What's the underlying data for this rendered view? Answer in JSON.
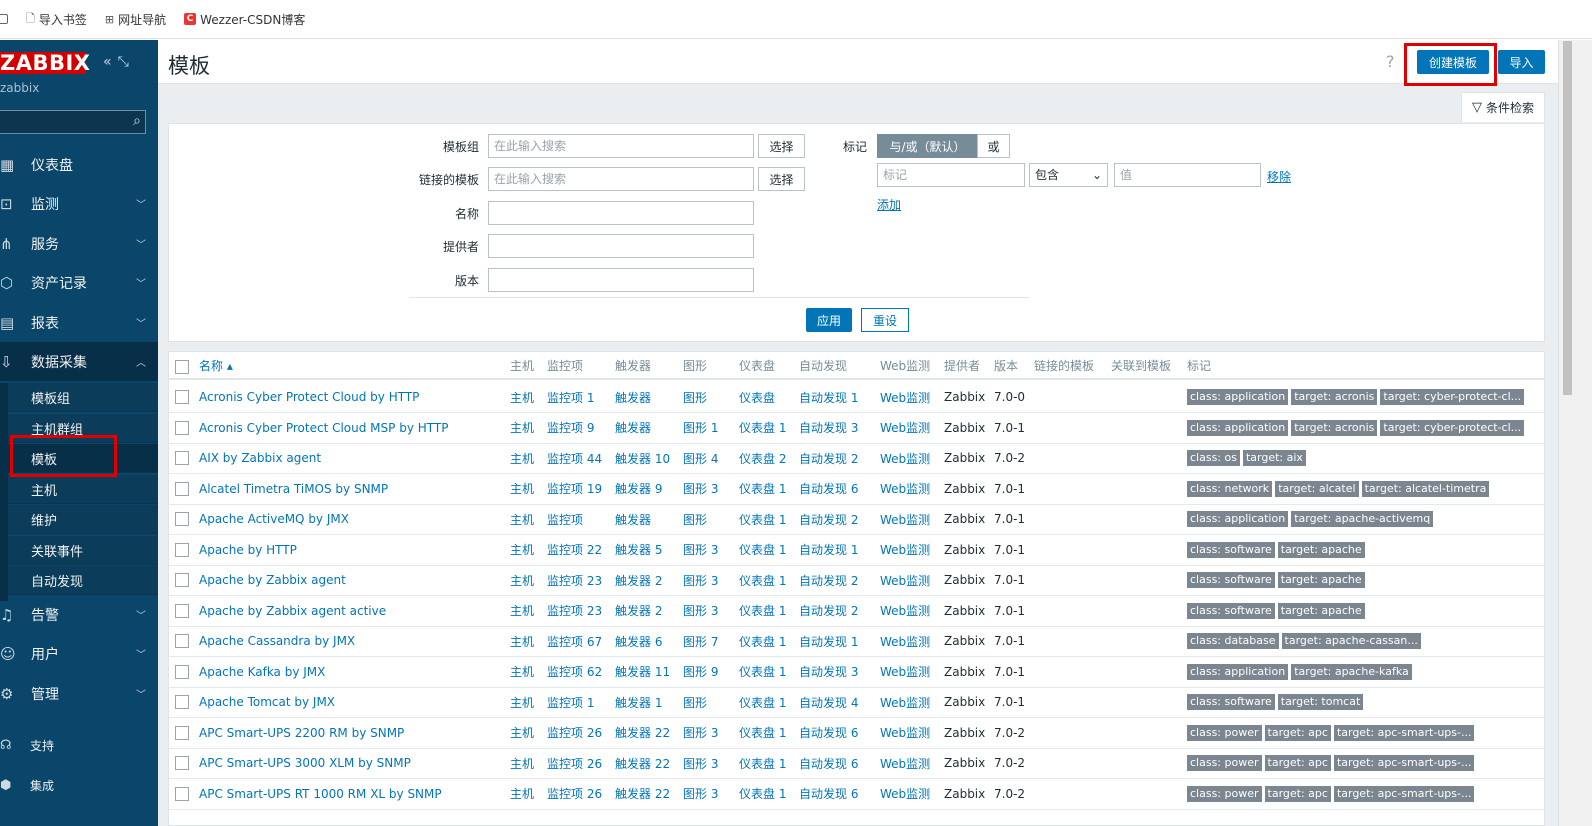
{
  "bookmarks": [
    {
      "label": "导入书签"
    },
    {
      "label": "网址导航"
    },
    {
      "label": "Wezzer-CSDN博客"
    }
  ],
  "sidebar": {
    "logo": "ZABBIX",
    "user": "zabbix",
    "nav": [
      {
        "label": "仪表盘",
        "icon": "grid-icon"
      },
      {
        "label": "监测",
        "icon": "monitor-icon"
      },
      {
        "label": "服务",
        "icon": "tree-icon"
      },
      {
        "label": "资产记录",
        "icon": "cube-icon"
      },
      {
        "label": "报表",
        "icon": "report-icon"
      },
      {
        "label": "数据采集",
        "icon": "download-icon"
      }
    ],
    "sub": [
      "模板组",
      "主机群组",
      "模板",
      "主机",
      "维护",
      "关联事件",
      "自动发现"
    ],
    "nav2": [
      {
        "label": "告警",
        "icon": "bell-icon"
      },
      {
        "label": "用户",
        "icon": "user-icon"
      },
      {
        "label": "管理",
        "icon": "gear-icon"
      }
    ],
    "small": [
      {
        "label": "支持",
        "icon": "headset-icon"
      },
      {
        "label": "集成",
        "icon": "box-icon"
      }
    ]
  },
  "header": {
    "title": "模板",
    "help": "?",
    "create": "创建模板",
    "import": "导入"
  },
  "filter": {
    "tab": "条件检索",
    "labels": {
      "group": "模板组",
      "linked": "链接的模板",
      "name": "名称",
      "vendor": "提供者",
      "version": "版本",
      "tags": "标记"
    },
    "placeholder": "在此输入搜索",
    "select": "选择",
    "andor": "与/或（默认）",
    "or": "或",
    "tag_ph": "标记",
    "op": "包含",
    "val_ph": "值",
    "remove": "移除",
    "add": "添加",
    "apply": "应用",
    "reset": "重设"
  },
  "table": {
    "headers": [
      "名称 ▴",
      "主机",
      "监控项",
      "触发器",
      "图形",
      "仪表盘",
      "自动发现",
      "Web监测",
      "提供者",
      "版本",
      "链接的模板",
      "关联到模板",
      "标记"
    ],
    "rows": [
      {
        "name": "Acronis Cyber Protect Cloud by HTTP",
        "host": "主机",
        "items": "监控项 1",
        "trig": "触发器",
        "graph": "图形",
        "dash": "仪表盘",
        "disc": "自动发现 1",
        "web": "Web监测",
        "vendor": "Zabbix",
        "ver": "7.0-0",
        "tags": [
          "class: application",
          "target: acronis",
          "target: cyber-protect-cl..."
        ]
      },
      {
        "name": "Acronis Cyber Protect Cloud MSP by HTTP",
        "host": "主机",
        "items": "监控项 9",
        "trig": "触发器",
        "graph": "图形 1",
        "dash": "仪表盘 1",
        "disc": "自动发现 3",
        "web": "Web监测",
        "vendor": "Zabbix",
        "ver": "7.0-1",
        "tags": [
          "class: application",
          "target: acronis",
          "target: cyber-protect-cl..."
        ]
      },
      {
        "name": "AIX by Zabbix agent",
        "host": "主机",
        "items": "监控项 44",
        "trig": "触发器 10",
        "graph": "图形 4",
        "dash": "仪表盘 2",
        "disc": "自动发现 2",
        "web": "Web监测",
        "vendor": "Zabbix",
        "ver": "7.0-2",
        "tags": [
          "class: os",
          "target: aix"
        ]
      },
      {
        "name": "Alcatel Timetra TiMOS by SNMP",
        "host": "主机",
        "items": "监控项 19",
        "trig": "触发器 9",
        "graph": "图形 3",
        "dash": "仪表盘 1",
        "disc": "自动发现 6",
        "web": "Web监测",
        "vendor": "Zabbix",
        "ver": "7.0-1",
        "tags": [
          "class: network",
          "target: alcatel",
          "target: alcatel-timetra"
        ]
      },
      {
        "name": "Apache ActiveMQ by JMX",
        "host": "主机",
        "items": "监控项",
        "trig": "触发器",
        "graph": "图形",
        "dash": "仪表盘 1",
        "disc": "自动发现 2",
        "web": "Web监测",
        "vendor": "Zabbix",
        "ver": "7.0-1",
        "tags": [
          "class: application",
          "target: apache-activemq"
        ]
      },
      {
        "name": "Apache by HTTP",
        "host": "主机",
        "items": "监控项 22",
        "trig": "触发器 5",
        "graph": "图形 3",
        "dash": "仪表盘 1",
        "disc": "自动发现 1",
        "web": "Web监测",
        "vendor": "Zabbix",
        "ver": "7.0-1",
        "tags": [
          "class: software",
          "target: apache"
        ]
      },
      {
        "name": "Apache by Zabbix agent",
        "host": "主机",
        "items": "监控项 23",
        "trig": "触发器 2",
        "graph": "图形 3",
        "dash": "仪表盘 1",
        "disc": "自动发现 2",
        "web": "Web监测",
        "vendor": "Zabbix",
        "ver": "7.0-1",
        "tags": [
          "class: software",
          "target: apache"
        ]
      },
      {
        "name": "Apache by Zabbix agent active",
        "host": "主机",
        "items": "监控项 23",
        "trig": "触发器 2",
        "graph": "图形 3",
        "dash": "仪表盘 1",
        "disc": "自动发现 2",
        "web": "Web监测",
        "vendor": "Zabbix",
        "ver": "7.0-1",
        "tags": [
          "class: software",
          "target: apache"
        ]
      },
      {
        "name": "Apache Cassandra by JMX",
        "host": "主机",
        "items": "监控项 67",
        "trig": "触发器 6",
        "graph": "图形 7",
        "dash": "仪表盘 1",
        "disc": "自动发现 1",
        "web": "Web监测",
        "vendor": "Zabbix",
        "ver": "7.0-1",
        "tags": [
          "class: database",
          "target: apache-cassan..."
        ]
      },
      {
        "name": "Apache Kafka by JMX",
        "host": "主机",
        "items": "监控项 62",
        "trig": "触发器 11",
        "graph": "图形 9",
        "dash": "仪表盘 1",
        "disc": "自动发现 3",
        "web": "Web监测",
        "vendor": "Zabbix",
        "ver": "7.0-1",
        "tags": [
          "class: application",
          "target: apache-kafka"
        ]
      },
      {
        "name": "Apache Tomcat by JMX",
        "host": "主机",
        "items": "监控项 1",
        "trig": "触发器 1",
        "graph": "图形",
        "dash": "仪表盘 1",
        "disc": "自动发现 4",
        "web": "Web监测",
        "vendor": "Zabbix",
        "ver": "7.0-1",
        "tags": [
          "class: software",
          "target: tomcat"
        ]
      },
      {
        "name": "APC Smart-UPS 2200 RM by SNMP",
        "host": "主机",
        "items": "监控项 26",
        "trig": "触发器 22",
        "graph": "图形 3",
        "dash": "仪表盘 1",
        "disc": "自动发现 6",
        "web": "Web监测",
        "vendor": "Zabbix",
        "ver": "7.0-2",
        "tags": [
          "class: power",
          "target: apc",
          "target: apc-smart-ups-..."
        ]
      },
      {
        "name": "APC Smart-UPS 3000 XLM by SNMP",
        "host": "主机",
        "items": "监控项 26",
        "trig": "触发器 22",
        "graph": "图形 3",
        "dash": "仪表盘 1",
        "disc": "自动发现 6",
        "web": "Web监测",
        "vendor": "Zabbix",
        "ver": "7.0-2",
        "tags": [
          "class: power",
          "target: apc",
          "target: apc-smart-ups-..."
        ]
      },
      {
        "name": "APC Smart-UPS RT 1000 RM XL by SNMP",
        "host": "主机",
        "items": "监控项 26",
        "trig": "触发器 22",
        "graph": "图形 3",
        "dash": "仪表盘 1",
        "disc": "自动发现 6",
        "web": "Web监测",
        "vendor": "Zabbix",
        "ver": "7.0-2",
        "tags": [
          "class: power",
          "target: apc",
          "target: apc-smart-ups-..."
        ]
      }
    ]
  }
}
